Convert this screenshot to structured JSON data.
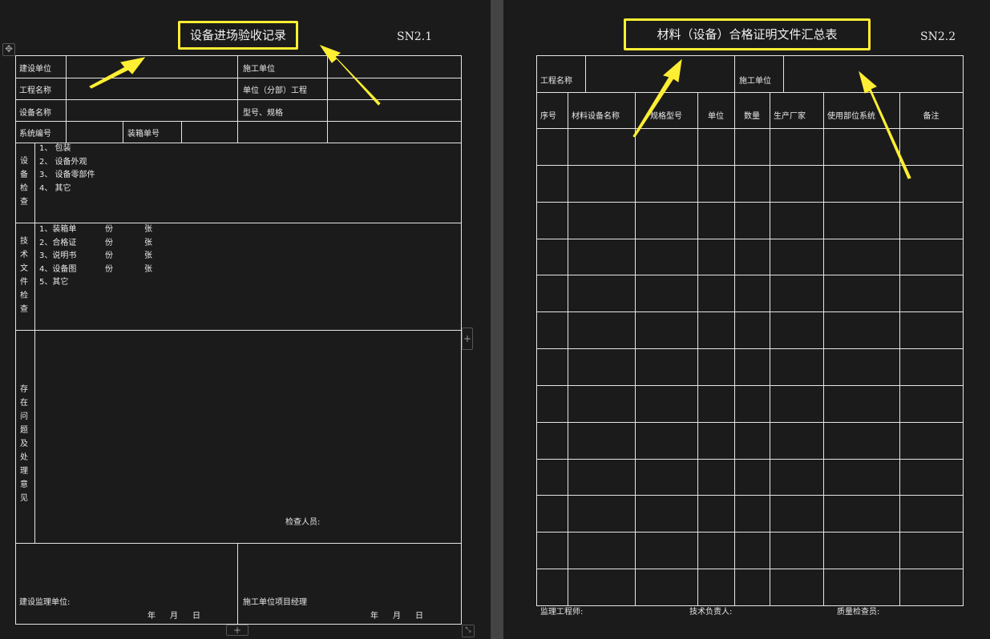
{
  "left": {
    "title": "设备进场验收记录",
    "code": "SN2.1",
    "labels": {
      "build_unit": "建设单位",
      "construct_unit": "施工单位",
      "project_name": "工程名称",
      "sub_project": "单位（分部）工程",
      "equipment_name": "设备名称",
      "model_spec": "型号、规格",
      "system_no": "系统编号",
      "packing_no": "装箱单号"
    },
    "equipment_check": {
      "side_label": "设备检查",
      "items": [
        "1、 包装",
        "2、 设备外观",
        "3、 设备零部件",
        "4、 其它"
      ]
    },
    "tech_docs": {
      "side_label": "技术文件检查",
      "items": [
        {
          "name": "1、装箱单",
          "unit1": "份",
          "unit2": "张"
        },
        {
          "name": "2、合格证",
          "unit1": "份",
          "unit2": "张"
        },
        {
          "name": "3、说明书",
          "unit1": "份",
          "unit2": "张"
        },
        {
          "name": "4、设备图",
          "unit1": "份",
          "unit2": "张"
        },
        {
          "name": "5、其它"
        }
      ]
    },
    "issues": {
      "side_label": "存在问题及处理意见",
      "inspector": "检查人员:"
    },
    "sign": {
      "supervisor": "建设监理单位:",
      "pm": "施工单位项目经理",
      "year": "年",
      "month": "月",
      "day": "日"
    }
  },
  "right": {
    "title": "材料（设备）合格证明文件汇总表",
    "code": "SN2.2",
    "project_name": "工程名称",
    "construct_unit": "施工单位",
    "columns": [
      "序号",
      "材料设备名称",
      "规格型号",
      "单位",
      "数量",
      "生产厂家",
      "使用部位系统",
      "备注"
    ],
    "empty_rows": 13,
    "footer": [
      "监理工程师:",
      "技术负责人:",
      "质量检查员:"
    ]
  },
  "colors": {
    "annotation": "#ffee33",
    "background": "#1b1b1b",
    "lines": "#e6e6e6"
  }
}
